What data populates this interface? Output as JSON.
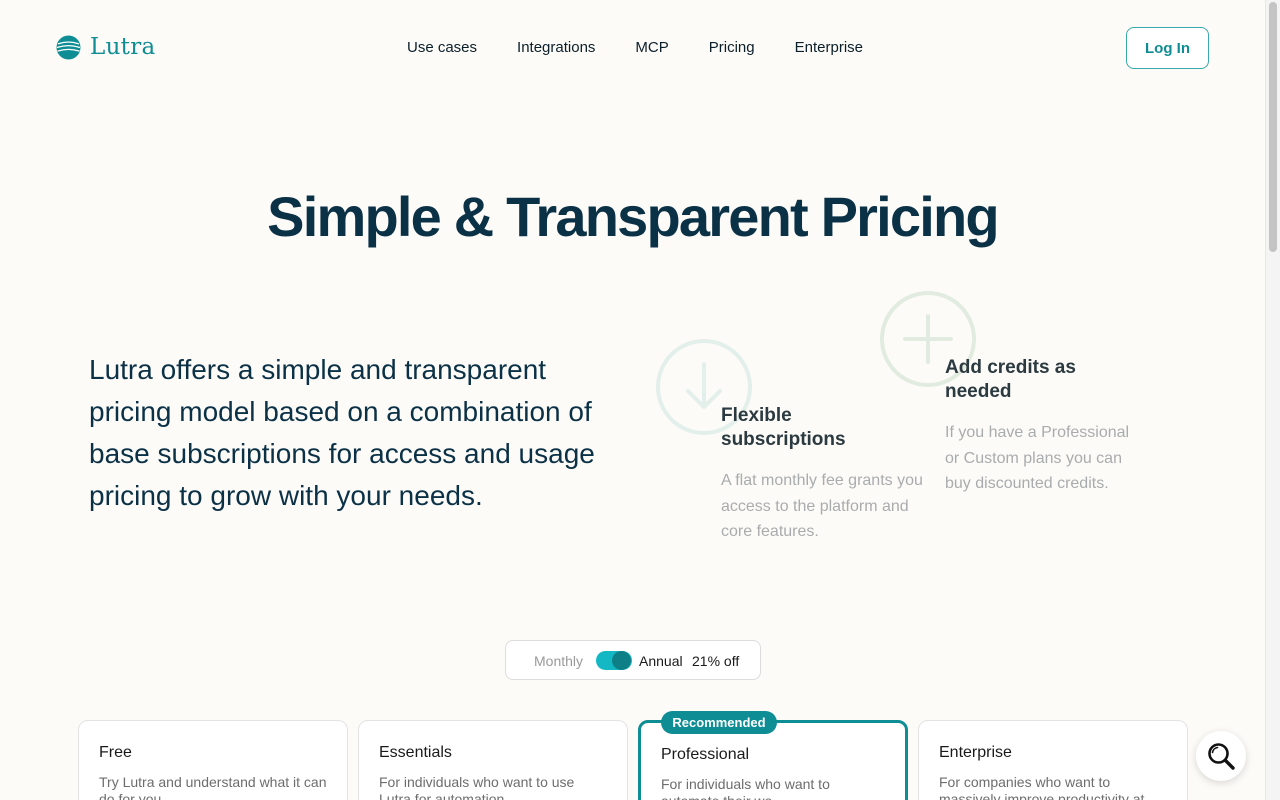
{
  "brand": {
    "name": "Lutra",
    "color": "#0e8d95"
  },
  "nav": {
    "items": [
      {
        "label": "Use cases"
      },
      {
        "label": "Integrations"
      },
      {
        "label": "MCP"
      },
      {
        "label": "Pricing"
      },
      {
        "label": "Enterprise"
      }
    ],
    "login_label": "Log In"
  },
  "hero": {
    "title": "Simple & Transparent Pricing",
    "intro": "Lutra offers a simple and transparent pricing model based on a combination of base subscriptions for access and usage pricing to grow with your needs."
  },
  "features": [
    {
      "icon": "download-circle-icon",
      "title": "Flexible subscriptions",
      "desc": "A flat monthly fee grants you access to the platform and core features."
    },
    {
      "icon": "plus-circle-icon",
      "title": "Add credits as needed",
      "desc": "If you have a Professional or Custom plans you can buy discounted credits."
    }
  ],
  "billing": {
    "monthly_label": "Monthly",
    "annual_label": "Annual",
    "discount_label": "21% off",
    "selected": "Annual"
  },
  "plans": [
    {
      "name": "Free",
      "desc": "Try Lutra and understand what it can do for you",
      "recommended": false
    },
    {
      "name": "Essentials",
      "desc": "For individuals who want to use Lutra for automation",
      "recommended": false
    },
    {
      "name": "Professional",
      "desc": "For individuals who want to automate their wo...",
      "recommended": true
    },
    {
      "name": "Enterprise",
      "desc": "For companies who want to massively improve productivity at",
      "recommended": false
    }
  ],
  "recommended_badge": "Recommended",
  "search_fab": {
    "icon": "search-icon"
  }
}
